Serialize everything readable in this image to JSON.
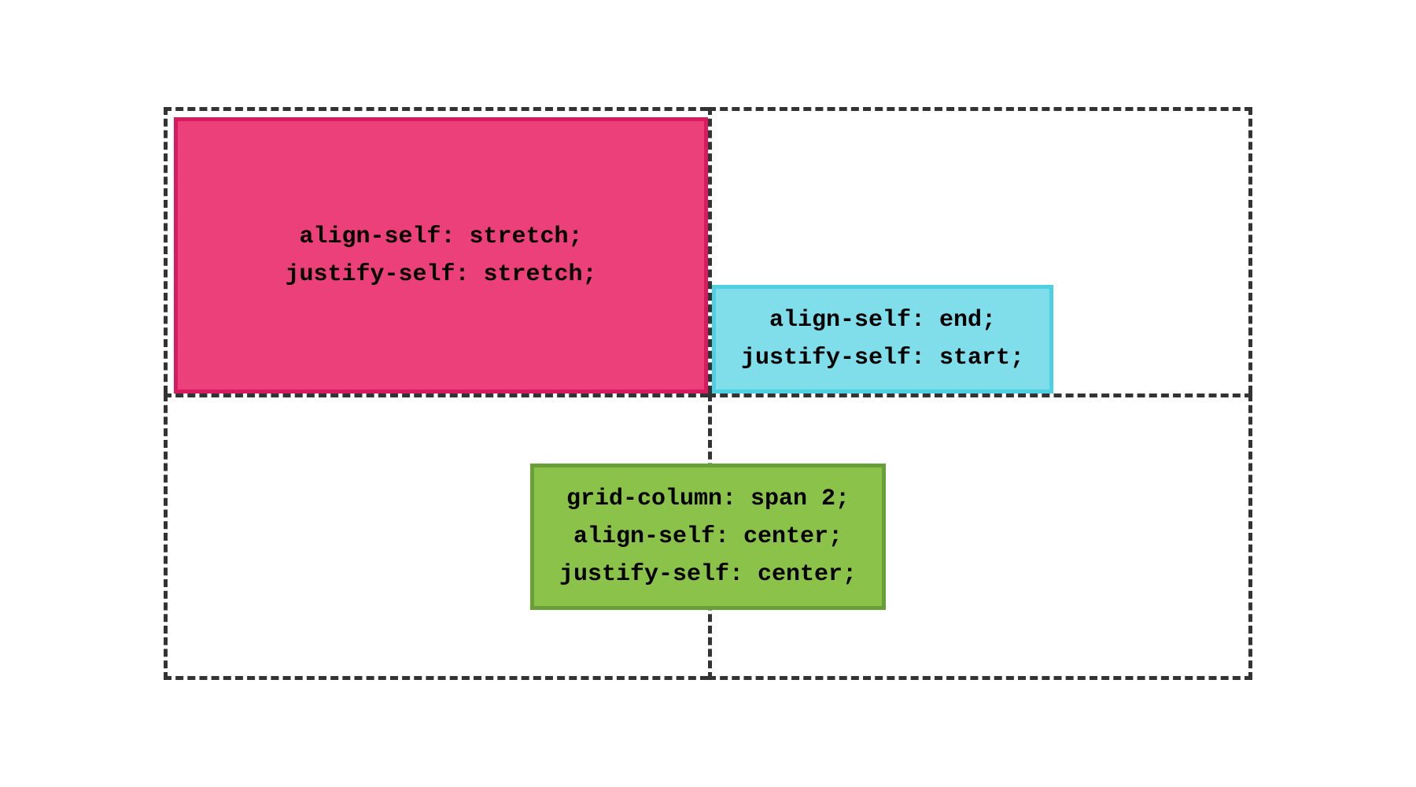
{
  "boxes": {
    "pink": {
      "line1": "align-self: stretch;",
      "line2": "justify-self: stretch;"
    },
    "blue": {
      "line1": "align-self: end;",
      "line2": "justify-self: start;"
    },
    "green": {
      "line1": "grid-column: span 2;",
      "line2": "align-self: center;",
      "line3": "justify-self: center;"
    }
  },
  "colors": {
    "pink_fill": "#EC407A",
    "pink_border": "#D81B60",
    "blue_fill": "#80DEEA",
    "blue_border": "#4DD0E1",
    "green_fill": "#8BC34A",
    "green_border": "#689F38",
    "dash_border": "#333333"
  }
}
